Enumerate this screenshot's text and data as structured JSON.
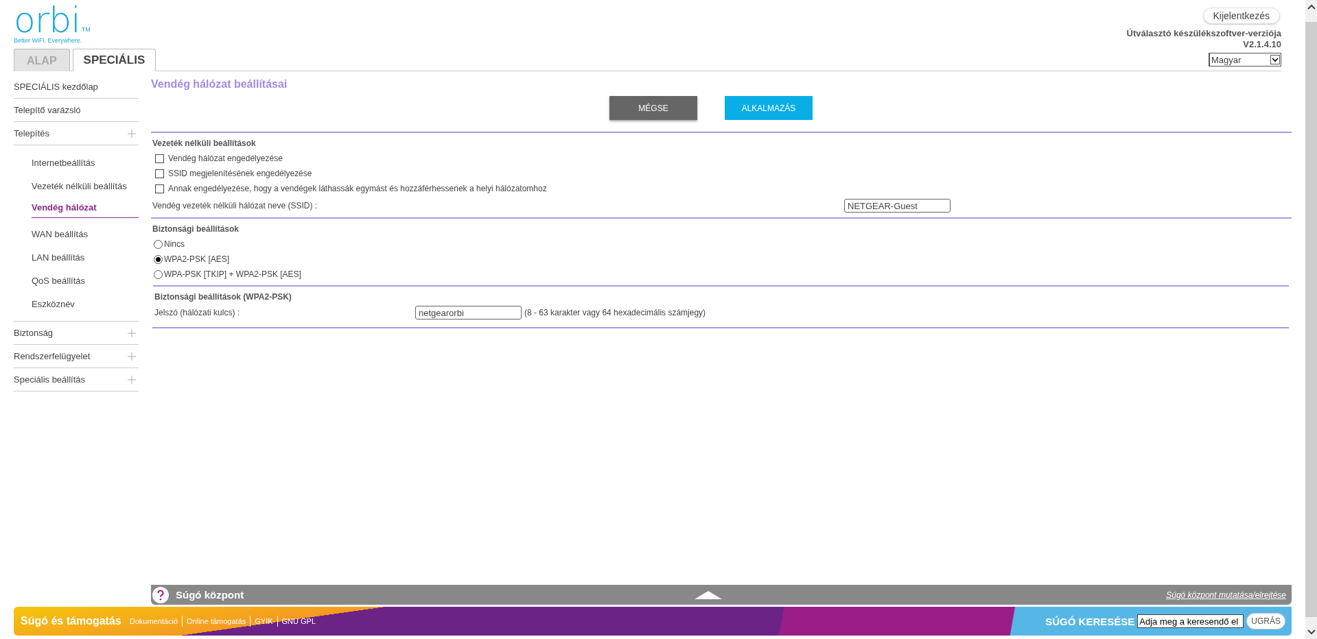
{
  "logo": {
    "name": "orbi",
    "mark": "TM",
    "tagline": "Better WiFi. Everywhere."
  },
  "tabs": [
    {
      "label": "ALAP",
      "selected": false
    },
    {
      "label": "SPECIÁLIS",
      "selected": true
    }
  ],
  "header": {
    "logout_button": "Kijelentkezés",
    "firmware_label": "Útválasztó készülékszoftver-verziója",
    "firmware_version": "V2.1.4.10",
    "language": "Magyar"
  },
  "sidebar": {
    "items": [
      {
        "label": "SPECIÁLIS kezdőlap",
        "expandable": false,
        "selected": false
      },
      {
        "label": "Telepítő varázsló",
        "expandable": false,
        "selected": false
      },
      {
        "label": "Telepítés",
        "expandable": true,
        "selected": false,
        "children": [
          {
            "label": "Internetbeállítás",
            "selected": false
          },
          {
            "label": "Vezeték nélküli beállítás",
            "selected": false
          },
          {
            "label": "Vendég hálózat",
            "selected": true
          },
          {
            "label": "WAN beállítás",
            "selected": false
          },
          {
            "label": "LAN beállítás",
            "selected": false
          },
          {
            "label": "QoS beállítás",
            "selected": false
          },
          {
            "label": "Eszköznév",
            "selected": false
          }
        ]
      },
      {
        "label": "Biztonság",
        "expandable": true,
        "selected": false
      },
      {
        "label": "Rendszerfelügyelet",
        "expandable": true,
        "selected": false
      },
      {
        "label": "Speciális beállítás",
        "expandable": true,
        "selected": false
      }
    ]
  },
  "page": {
    "title": "Vendég hálózat beállításai",
    "buttons": [
      {
        "label": "MÉGSE",
        "kind": "cancel"
      },
      {
        "label": "ALKALMAZÁS",
        "kind": "apply"
      }
    ],
    "wireless": {
      "title": "Vezeték nélküli beállítások",
      "options": [
        {
          "label": "Vendég hálózat engedélyezése",
          "checked": false
        },
        {
          "label": "SSID megjelenítésének engedélyezése",
          "checked": false
        },
        {
          "label": "Annak engedélyezése, hogy a vendégek láthassák egymást és hozzáférhessenek a helyi hálózatomhoz",
          "checked": false
        }
      ],
      "ssid_label": "Vendég vezeték nélküli hálózat neve (SSID) :",
      "ssid_value": "NETGEAR-Guest"
    },
    "security": {
      "title": "Biztonsági beállítások",
      "options": [
        {
          "label": "Nincs",
          "selected": false
        },
        {
          "label": "WPA2-PSK [AES]",
          "selected": true
        },
        {
          "label": "WPA-PSK [TKIP] + WPA2-PSK [AES]",
          "selected": false
        }
      ]
    },
    "passphrase": {
      "title": "Biztonsági beállítások (WPA2-PSK)",
      "label": "Jelszó (hálózati kulcs) :",
      "value": "netgearorbi",
      "hint": "(8 - 63 karakter vagy 64 hexadecimális számjegy)"
    }
  },
  "help_bar": {
    "title": "Súgó központ",
    "toggle_link": "Súgó központ mutatása/elrejtése"
  },
  "footer": {
    "title": "Súgó és támogatás",
    "links": [
      "Dokumentáció",
      "Online támogatás",
      "GYIK",
      "GNU GPL"
    ],
    "search_label": "SÚGÓ KERESÉSE",
    "search_value": "Adja meg a keresendő el",
    "search_button": "UGRÁS"
  }
}
